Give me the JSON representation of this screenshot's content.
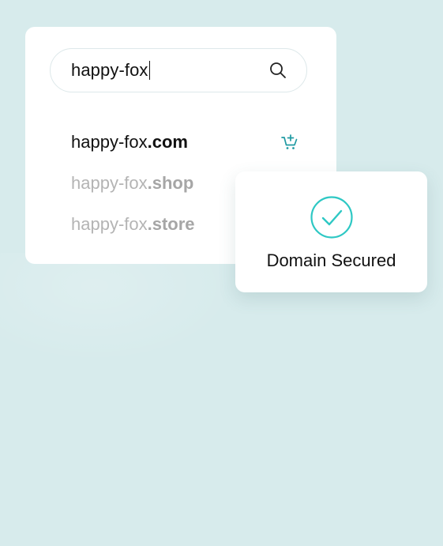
{
  "search": {
    "value": "happy-fox",
    "icon": "search-icon"
  },
  "results": [
    {
      "name": "happy-fox",
      "tld": ".com",
      "state": "available",
      "action_icon": "cart-add-icon"
    },
    {
      "name": "happy-fox",
      "tld": ".shop",
      "state": "muted"
    },
    {
      "name": "happy-fox",
      "tld": ".store",
      "state": "muted"
    }
  ],
  "status_card": {
    "label": "Domain Secured",
    "icon": "check-circle-icon"
  },
  "colors": {
    "background": "#d7ebec",
    "accent": "#2ec8c4",
    "cart_icon": "#1f9aa3",
    "text": "#111111",
    "muted_text": "#b4b4b4"
  }
}
